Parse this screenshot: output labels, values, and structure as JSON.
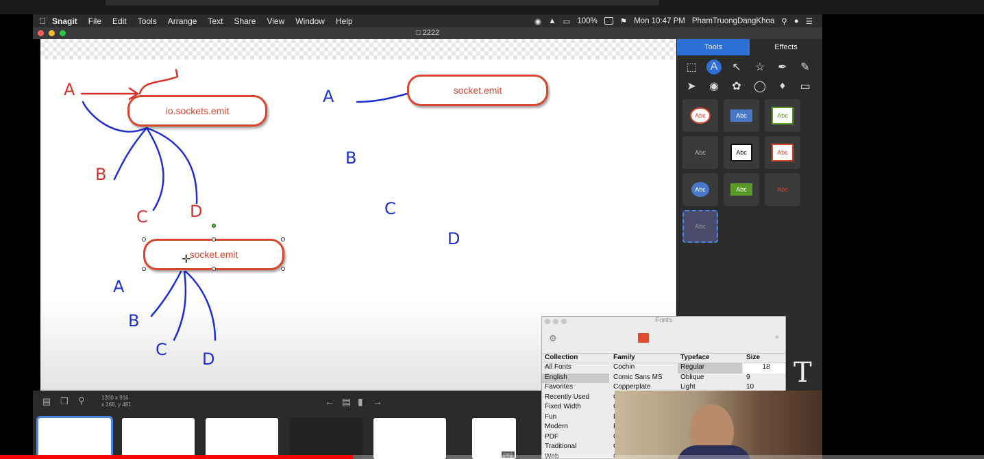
{
  "menubar": {
    "app": "Snagit",
    "items": [
      "File",
      "Edit",
      "Tools",
      "Arrange",
      "Text",
      "Share",
      "View",
      "Window",
      "Help"
    ],
    "battery": "100%",
    "clock": "Mon 10:47 PM",
    "user": "PhamTruongDangKhoa"
  },
  "window": {
    "title": "2222"
  },
  "canvas": {
    "pills": [
      "io.sockets.emit",
      "socket.emit",
      "socket.emit"
    ],
    "letters": [
      "A",
      "B",
      "C",
      "D"
    ]
  },
  "sidebar": {
    "tabs": [
      "Tools",
      "Effects"
    ],
    "style_label": "Abc"
  },
  "fonts_panel": {
    "title": "Fonts",
    "headers": {
      "collection": "Collection",
      "family": "Family",
      "typeface": "Typeface",
      "size": "Size"
    },
    "collections": [
      "All Fonts",
      "English",
      "Favorites",
      "Recently Used",
      "Fixed Width",
      "Fun",
      "Modern",
      "PDF",
      "Traditional",
      "Web"
    ],
    "families": [
      "Cochin",
      "Comic Sans MS",
      "Copperplate",
      "C",
      "C",
      "D",
      "F",
      "G",
      "G",
      "G"
    ],
    "typefaces": [
      "Regular",
      "Oblique",
      "Light"
    ],
    "sizes": [
      "9",
      "10"
    ],
    "size_value": "18"
  },
  "bottom": {
    "dims": "1200 x 916",
    "coords": "x 268, y 481",
    "thumb_tag": "png"
  },
  "colors": {
    "accent": "#2d6fd6",
    "pill": "#d9462e",
    "ink_blue": "#1d2ed4",
    "ink_red": "#d6322a",
    "progress": "#ff0000"
  }
}
